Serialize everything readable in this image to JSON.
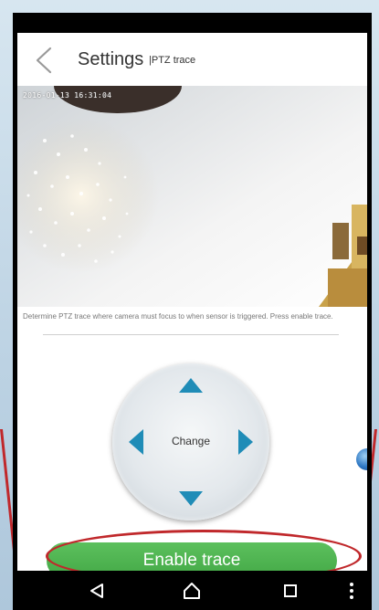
{
  "header": {
    "back_icon": "chevron-left-icon",
    "title": "Settings",
    "subtitle": "|PTZ trace"
  },
  "camera": {
    "timestamp": "2016-01-13 16:31:04"
  },
  "description": "Determine PTZ trace where camera must focus to when sensor is triggered. Press enable trace.",
  "joystick": {
    "center_label": "Change",
    "up_icon": "arrow-up-icon",
    "down_icon": "arrow-down-icon",
    "left_icon": "arrow-left-icon",
    "right_icon": "arrow-right-icon"
  },
  "enable_button": {
    "label": "Enable trace",
    "color": "#4cb24f"
  },
  "annotation_color": "#c0282b",
  "nav_bar": {
    "back_icon": "triangle-back-icon",
    "home_icon": "home-icon",
    "recent_icon": "square-recents-icon",
    "menu_icon": "more-vertical-icon"
  }
}
